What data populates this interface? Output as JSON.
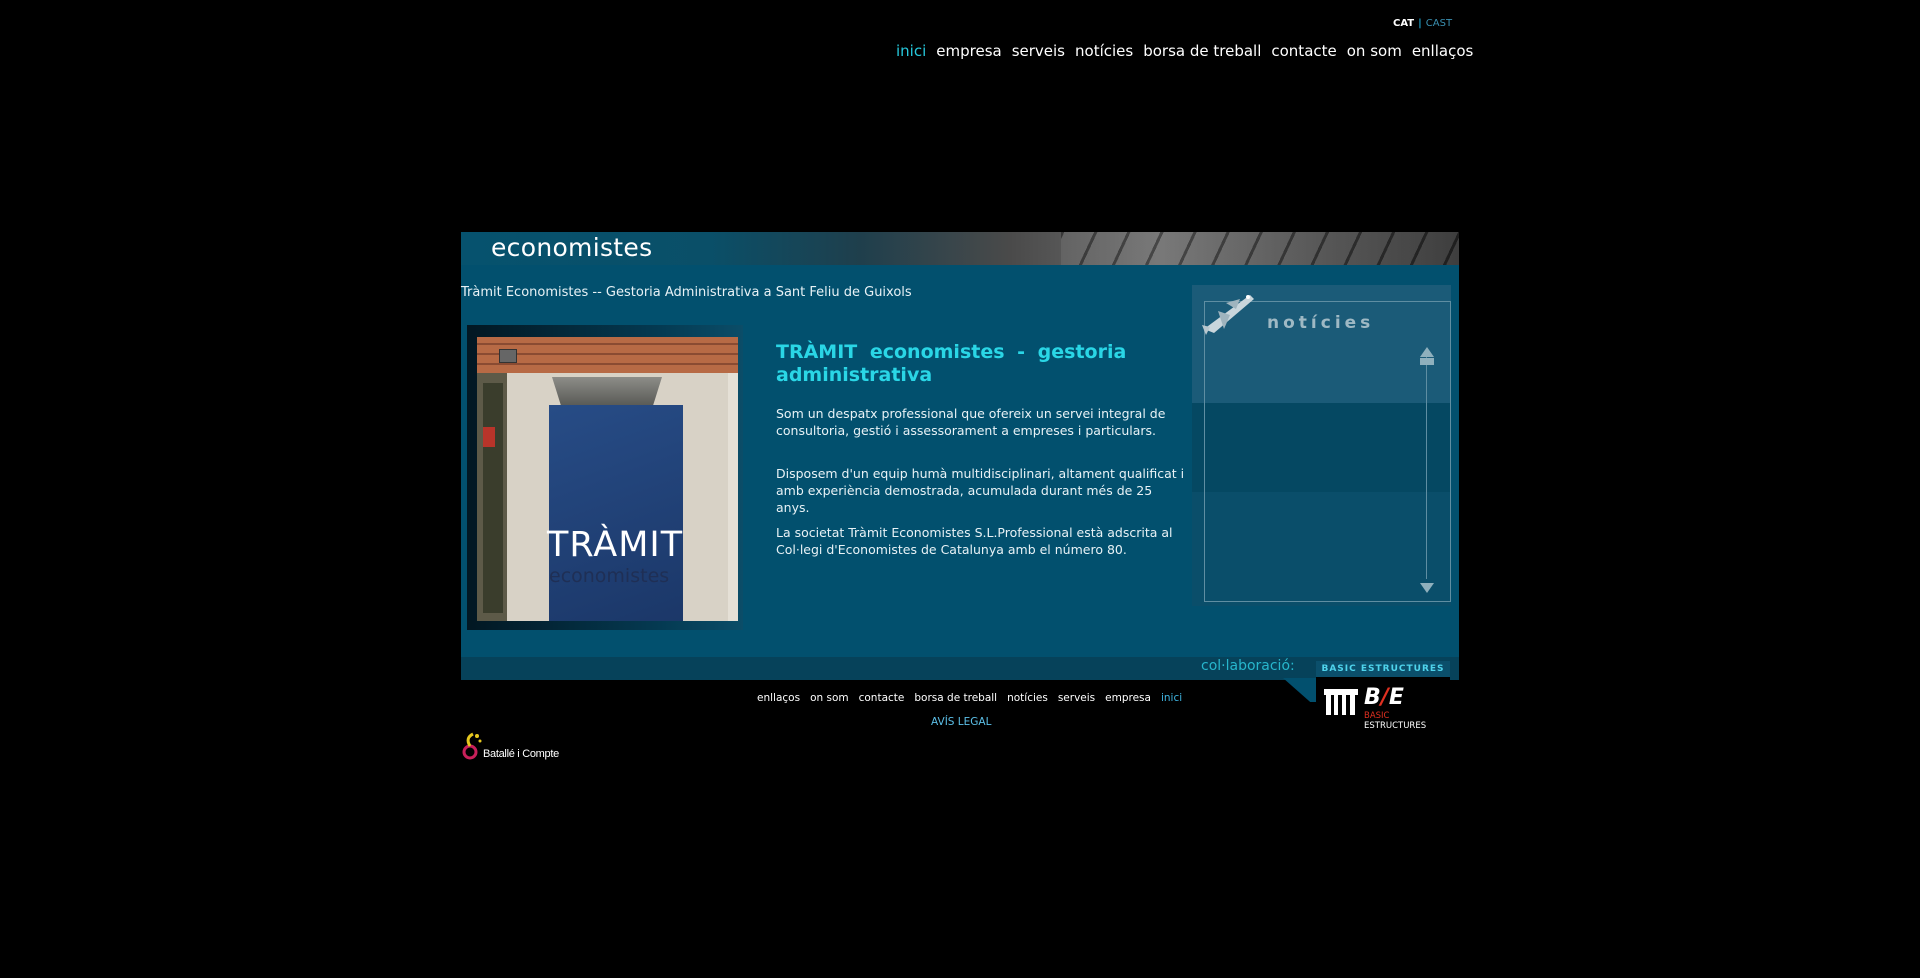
{
  "language": {
    "active": "CAT",
    "other": "CAST"
  },
  "top_nav": [
    {
      "label": "inici",
      "active": true
    },
    {
      "label": "empresa",
      "active": false
    },
    {
      "label": "serveis",
      "active": false
    },
    {
      "label": "notícies",
      "active": false
    },
    {
      "label": "borsa de treball",
      "active": false
    },
    {
      "label": "contacte",
      "active": false
    },
    {
      "label": "on som",
      "active": false
    },
    {
      "label": "enllaços",
      "active": false
    }
  ],
  "banner": {
    "word": "economistes"
  },
  "subtitle": "Tràmit Economistes -- Gestoria Administrativa a Sant Feliu de Guixols",
  "photo": {
    "sign_word": "TRÀMIT",
    "sign_sub": "economistes"
  },
  "content": {
    "heading": "TRÀMIT  economistes -  gestoria administrativa",
    "paragraphs": [
      "Som un despatx professional que ofereix un servei integral de consultoria, gestió i assessorament a empreses i particulars.",
      "Disposem d'un equip humà multidisciplinari, altament qualificat i amb experiència demostrada, acumulada durant més de 25 anys.",
      "La societat Tràmit Economistes S.L.Professional està adscrita al Col·legi d'Economistes de Catalunya amb el número 80."
    ]
  },
  "news": {
    "title": "notícies"
  },
  "collab": {
    "label": "col·laboració:"
  },
  "partner_logo": {
    "top": "BASIC ESTRUCTURES",
    "brand_left": "B",
    "brand_slash": "/",
    "brand_right": "E",
    "sub_left": "BASIC",
    "sub_right": "ESTRUCTURES"
  },
  "footer_nav": [
    {
      "label": "enllaços",
      "active": false
    },
    {
      "label": "on som",
      "active": false
    },
    {
      "label": "contacte",
      "active": false
    },
    {
      "label": "borsa de treball",
      "active": false
    },
    {
      "label": "notícies",
      "active": false
    },
    {
      "label": "serveis",
      "active": false
    },
    {
      "label": "empresa",
      "active": false
    },
    {
      "label": "inici",
      "active": true
    }
  ],
  "legal": "AVÍS LEGAL",
  "designer": {
    "name": "Batallé i Compte"
  },
  "colors": {
    "accent": "#26c8dc",
    "panel": "#02506e",
    "background": "#000000"
  }
}
